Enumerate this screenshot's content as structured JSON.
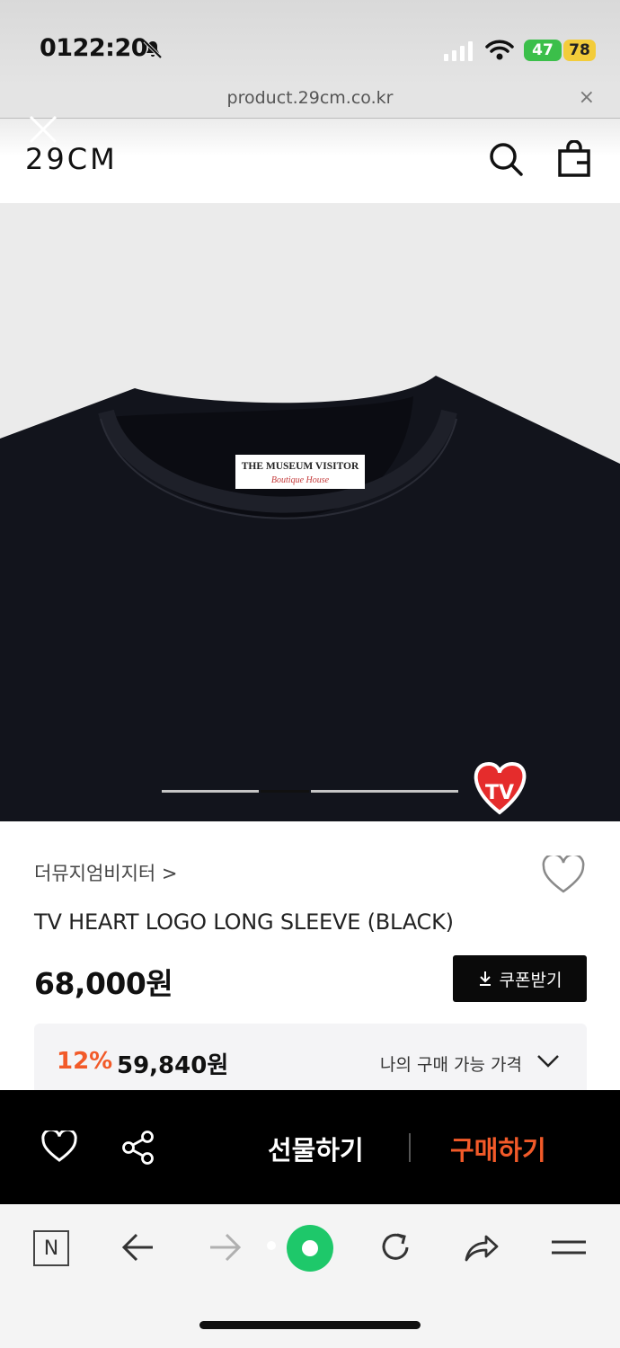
{
  "status_bar": {
    "time": "0122:20",
    "green_badge": "47",
    "battery": "78"
  },
  "browser": {
    "url": "product.29cm.co.kr",
    "close_label": "×"
  },
  "site": {
    "logo": "29CM"
  },
  "product_image": {
    "label_line1": "THE MUSEUM VISITOR",
    "label_line2": "Boutique House",
    "badge_text": "TV",
    "carousel_total": 3,
    "carousel_active_index": 1
  },
  "product": {
    "brand": "더뮤지엄비지터 >",
    "title": "TV HEART LOGO LONG SLEEVE (BLACK)",
    "price": "68,000원",
    "coupon_label": "쿠폰받기",
    "discount_rate": "12%",
    "discount_price": "59,840원",
    "price_toggle_label": "나의 구매 가능 가격"
  },
  "action_bar": {
    "gift_label": "선물하기",
    "buy_label": "구매하기"
  },
  "toolbar": {
    "n_label": "N"
  },
  "colors": {
    "accent": "#f25a29",
    "black": "#000000",
    "green": "#1ec86a"
  }
}
